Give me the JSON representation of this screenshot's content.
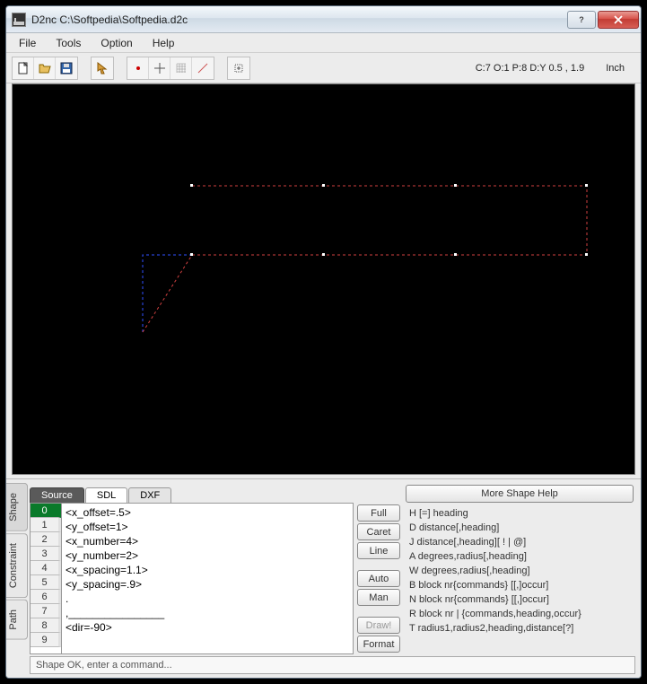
{
  "window": {
    "title": "D2nc C:\\Softpedia\\Softpedia.d2c"
  },
  "menu": {
    "items": [
      "File",
      "Tools",
      "Option",
      "Help"
    ]
  },
  "toolbar": {
    "status": "C:7  O:1  P:8  D:Y    0.5 , 1.9",
    "unit": "Inch"
  },
  "tabs": {
    "vertical": [
      "Shape",
      "Constraint",
      "Path"
    ],
    "horizontal": [
      "Source",
      "SDL",
      "DXF"
    ]
  },
  "source": {
    "line_numbers": [
      "0",
      "1",
      "2",
      "3",
      "4",
      "5",
      "6",
      "7",
      "8",
      "9"
    ],
    "text": "<x_offset=.5>\n<y_offset=1>\n<x_number=4>\n<y_number=2>\n<x_spacing=1.1>\n<y_spacing=.9>\n.\n,________________\n<dir=-90>"
  },
  "buttons": {
    "full": "Full",
    "caret": "Caret",
    "line": "Line",
    "auto": "Auto",
    "man": "Man",
    "draw": "Draw!",
    "format": "Format"
  },
  "help": {
    "more": "More Shape Help",
    "lines": [
      "H [=] heading",
      "D distance[,heading]",
      "J distance[,heading][ ! | @]",
      "A degrees,radius[,heading]",
      "W degrees,radius[,heading]",
      "B block nr{commands} [[,]occur]",
      "N block nr{commands} [[,]occur]",
      "R block nr | {commands,heading,occur}",
      "T radius1,radius2,heading,distance[?]"
    ]
  },
  "status": {
    "text": "Shape OK, enter a command..."
  }
}
